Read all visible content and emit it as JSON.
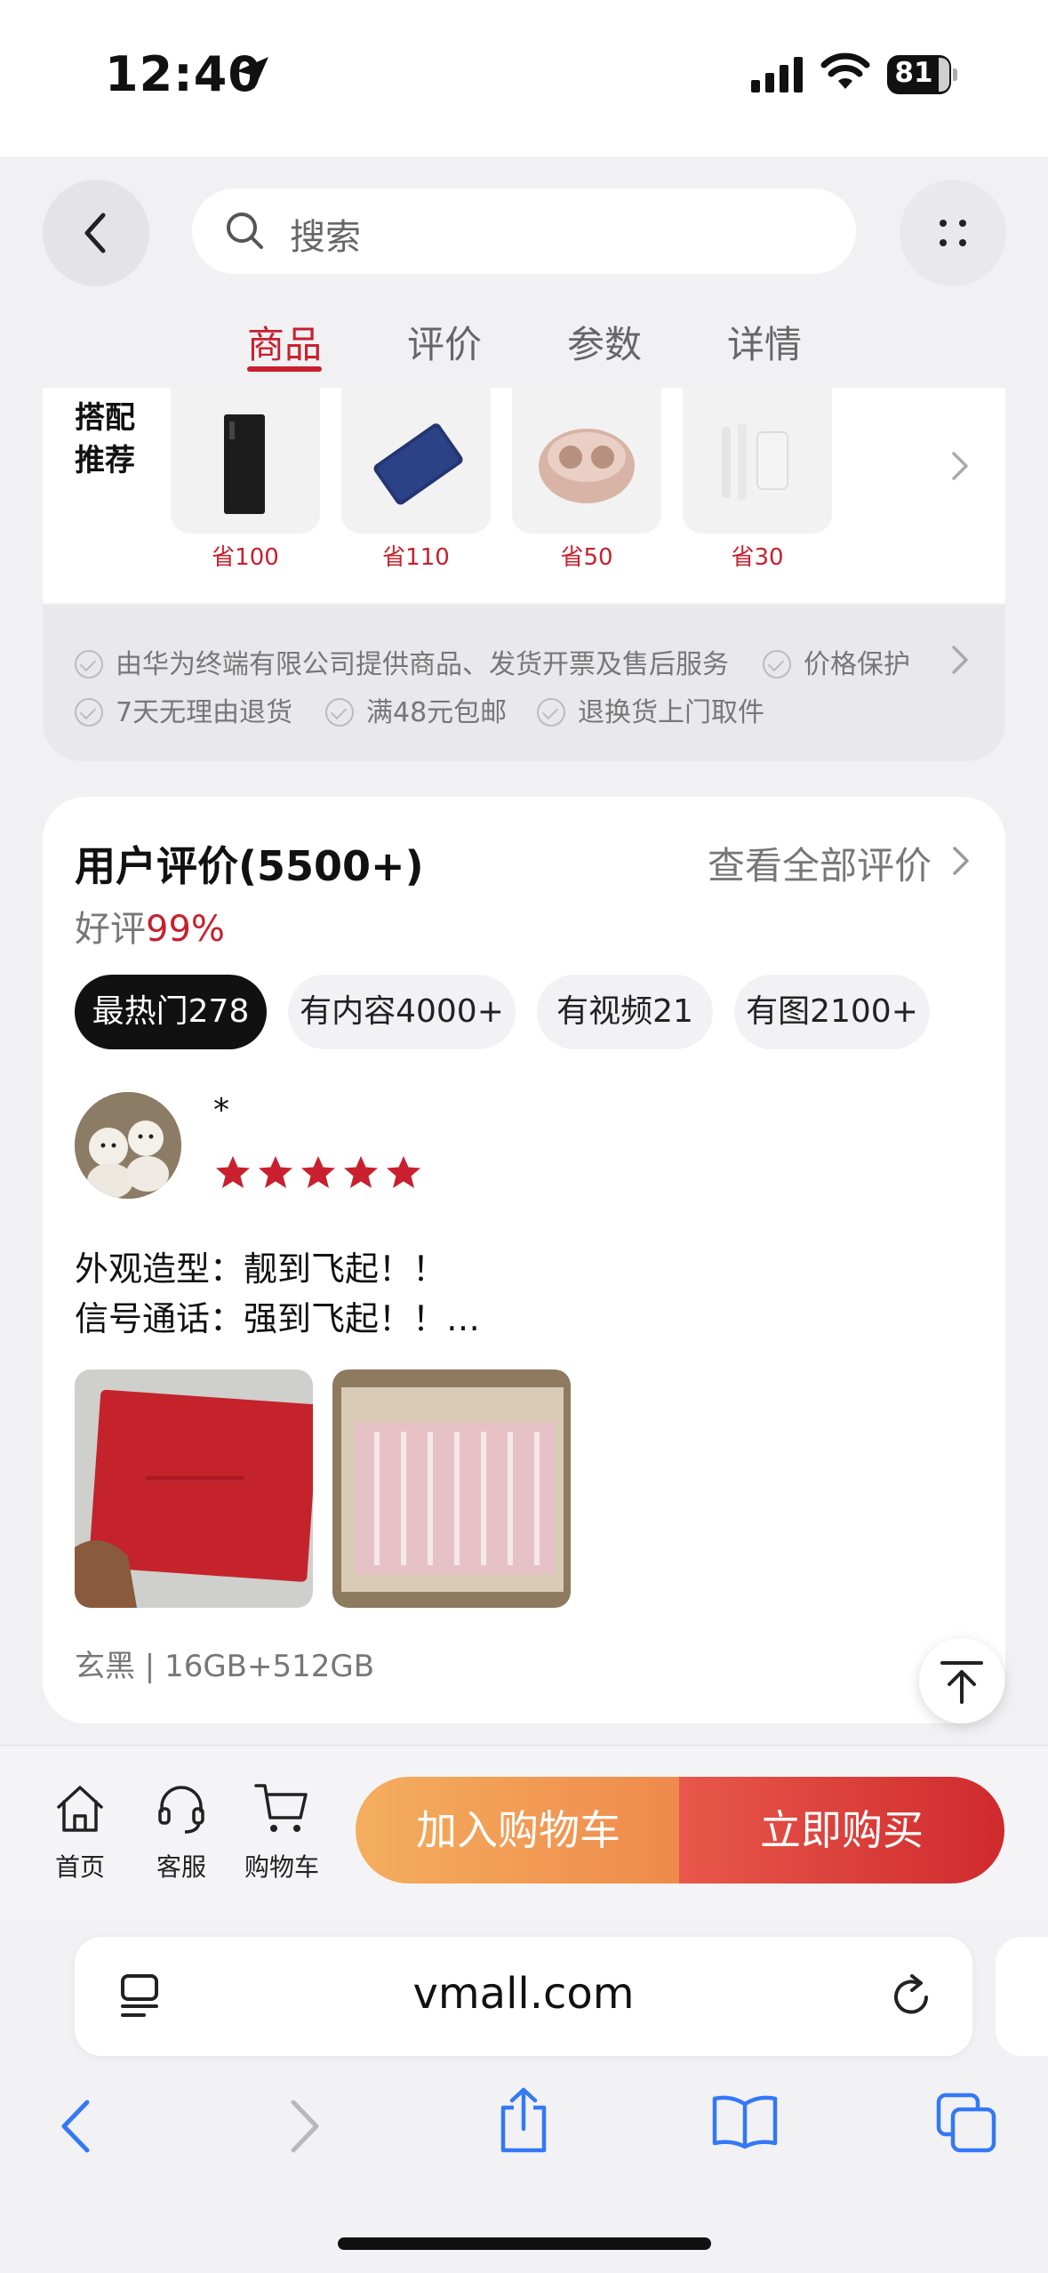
{
  "status_bar": {
    "time": "12:40",
    "battery": "81"
  },
  "search": {
    "placeholder": "搜索"
  },
  "tabs": [
    {
      "label": "商品",
      "active": true
    },
    {
      "label": "评价",
      "active": false
    },
    {
      "label": "参数",
      "active": false
    },
    {
      "label": "详情",
      "active": false
    }
  ],
  "bundle": {
    "title": "搭配推荐",
    "items": [
      {
        "save": "省100",
        "image": "desktop-tower"
      },
      {
        "save": "省110",
        "image": "blue-ssd"
      },
      {
        "save": "省50",
        "image": "pink-earbuds-case"
      },
      {
        "save": "省30",
        "image": "white-charger"
      }
    ]
  },
  "services": {
    "row1": [
      "由华为终端有限公司提供商品、发货开票及售后服务",
      "价格保护"
    ],
    "row2": [
      "7天无理由退货",
      "满48元包邮",
      "退换货上门取件"
    ]
  },
  "reviews": {
    "title": "用户评价(5500+)",
    "view_all": "查看全部评价",
    "good_rate_label": "好评",
    "good_rate_value": "99%",
    "filters": [
      {
        "label": "最热门278",
        "active": true
      },
      {
        "label": "有内容4000+",
        "active": false
      },
      {
        "label": "有视频21",
        "active": false
      },
      {
        "label": "有图2100+",
        "active": false
      }
    ],
    "item": {
      "user": "*",
      "stars": 5,
      "lines": [
        "外观造型：靓到飞起！！",
        "信号通话：强到飞起！！…"
      ],
      "variant": "玄黑 | 16GB+512GB"
    }
  },
  "bottom_nav": {
    "home": "首页",
    "service": "客服",
    "cart": "购物车",
    "add_to_cart": "加入购物车",
    "buy_now": "立即购买"
  },
  "browser": {
    "url": "vmall.com"
  },
  "colors": {
    "accent": "#c8202e",
    "cart_button": "#ef9a52",
    "buy_button": "#d8363a",
    "browser_blue": "#3478f6"
  }
}
